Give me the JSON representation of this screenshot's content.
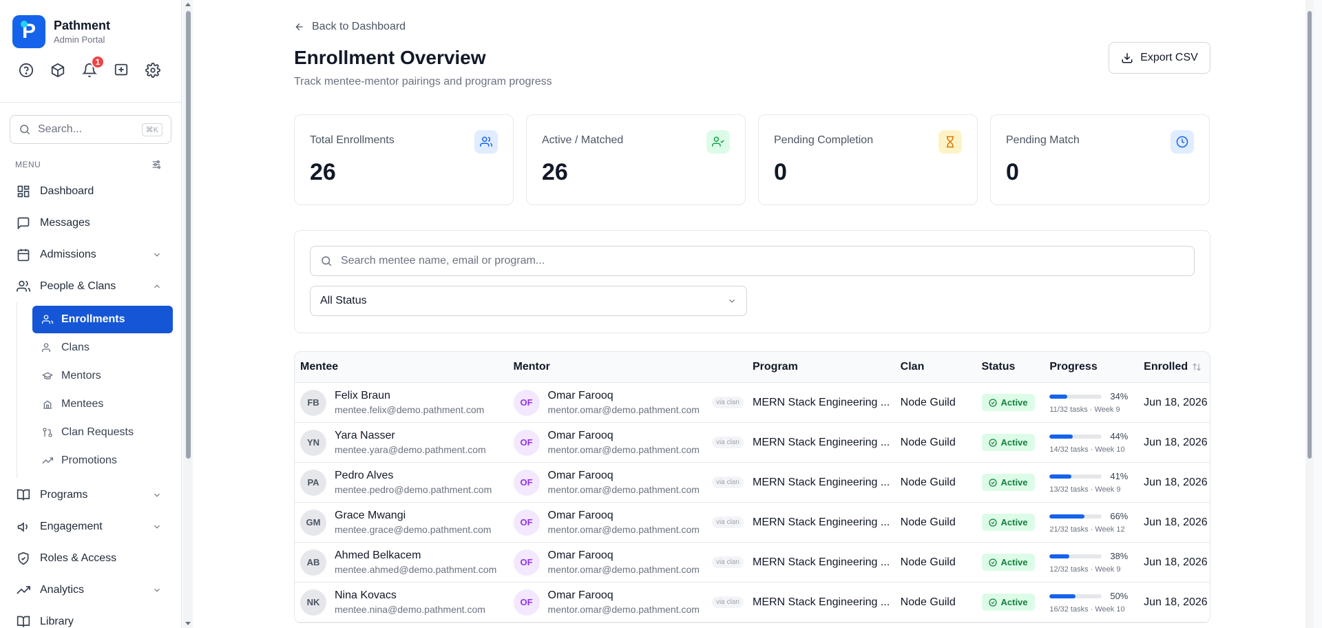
{
  "brand": {
    "name": "Pathment",
    "subtitle": "Admin Portal",
    "logo_letter": "P"
  },
  "quick_actions": [
    {
      "icon": "help-circle-icon"
    },
    {
      "icon": "package-icon"
    },
    {
      "icon": "bell-icon",
      "badge": "1"
    },
    {
      "icon": "message-plus-icon"
    },
    {
      "icon": "gear-icon"
    }
  ],
  "sidebar_search": {
    "placeholder": "Search...",
    "shortcut": "⌘K"
  },
  "menu_label": "MENU",
  "nav": {
    "dashboard": "Dashboard",
    "messages": "Messages",
    "admissions": "Admissions",
    "people_clans": "People & Clans",
    "sub": {
      "enrollments": "Enrollments",
      "clans": "Clans",
      "mentors": "Mentors",
      "mentees": "Mentees",
      "clan_requests": "Clan Requests",
      "promotions": "Promotions"
    },
    "programs": "Programs",
    "engagement": "Engagement",
    "roles_access": "Roles & Access",
    "analytics": "Analytics",
    "library": "Library"
  },
  "page": {
    "back": "Back to Dashboard",
    "title": "Enrollment Overview",
    "subtitle": "Track mentee-mentor pairings and program progress",
    "export": "Export CSV"
  },
  "stats": {
    "total": {
      "label": "Total Enrollments",
      "value": "26"
    },
    "active": {
      "label": "Active / Matched",
      "value": "26"
    },
    "pending_completion": {
      "label": "Pending Completion",
      "value": "0"
    },
    "pending_match": {
      "label": "Pending Match",
      "value": "0"
    }
  },
  "filters": {
    "search_placeholder": "Search mentee name, email or program...",
    "status_value": "All Status"
  },
  "table": {
    "headers": {
      "mentee": "Mentee",
      "mentor": "Mentor",
      "program": "Program",
      "clan": "Clan",
      "status": "Status",
      "progress": "Progress",
      "enrolled": "Enrolled"
    },
    "rows": [
      {
        "mi": "FB",
        "mentee": "Felix Braun",
        "memail": "mentee.felix@demo.pathment.com",
        "ti": "OF",
        "mentor": "Omar Farooq",
        "temail": "mentor.omar@demo.pathment.com",
        "via": "via clan",
        "program": "MERN Stack Engineering ...",
        "clan": "Node Guild",
        "status": "Active",
        "pct": "34%",
        "progress": 0.34,
        "detail": "11/32 tasks · Week 9",
        "enrolled": "Jun 18, 2026"
      },
      {
        "mi": "YN",
        "mentee": "Yara Nasser",
        "memail": "mentee.yara@demo.pathment.com",
        "ti": "OF",
        "mentor": "Omar Farooq",
        "temail": "mentor.omar@demo.pathment.com",
        "via": "via clan",
        "program": "MERN Stack Engineering ...",
        "clan": "Node Guild",
        "status": "Active",
        "pct": "44%",
        "progress": 0.44,
        "detail": "14/32 tasks · Week 10",
        "enrolled": "Jun 18, 2026"
      },
      {
        "mi": "PA",
        "mentee": "Pedro Alves",
        "memail": "mentee.pedro@demo.pathment.com",
        "ti": "OF",
        "mentor": "Omar Farooq",
        "temail": "mentor.omar@demo.pathment.com",
        "via": "via clan",
        "program": "MERN Stack Engineering ...",
        "clan": "Node Guild",
        "status": "Active",
        "pct": "41%",
        "progress": 0.41,
        "detail": "13/32 tasks · Week 9",
        "enrolled": "Jun 18, 2026"
      },
      {
        "mi": "GM",
        "mentee": "Grace Mwangi",
        "memail": "mentee.grace@demo.pathment.com",
        "ti": "OF",
        "mentor": "Omar Farooq",
        "temail": "mentor.omar@demo.pathment.com",
        "via": "via clan",
        "program": "MERN Stack Engineering ...",
        "clan": "Node Guild",
        "status": "Active",
        "pct": "66%",
        "progress": 0.66,
        "detail": "21/32 tasks · Week 12",
        "enrolled": "Jun 18, 2026"
      },
      {
        "mi": "AB",
        "mentee": "Ahmed Belkacem",
        "memail": "mentee.ahmed@demo.pathment.com",
        "ti": "OF",
        "mentor": "Omar Farooq",
        "temail": "mentor.omar@demo.pathment.com",
        "via": "via clan",
        "program": "MERN Stack Engineering ...",
        "clan": "Node Guild",
        "status": "Active",
        "pct": "38%",
        "progress": 0.38,
        "detail": "12/32 tasks · Week 9",
        "enrolled": "Jun 18, 2026"
      },
      {
        "mi": "NK",
        "mentee": "Nina Kovacs",
        "memail": "mentee.nina@demo.pathment.com",
        "ti": "OF",
        "mentor": "Omar Farooq",
        "temail": "mentor.omar@demo.pathment.com",
        "via": "via clan",
        "program": "MERN Stack Engineering ...",
        "clan": "Node Guild",
        "status": "Active",
        "pct": "50%",
        "progress": 0.5,
        "detail": "16/32 tasks · Week 10",
        "enrolled": "Jun 18, 2026"
      }
    ]
  },
  "colors": {
    "accent": "#1563ea",
    "active_nav": "#1456d6",
    "status_bg": "#dcfce7",
    "status_fg": "#15803d"
  }
}
